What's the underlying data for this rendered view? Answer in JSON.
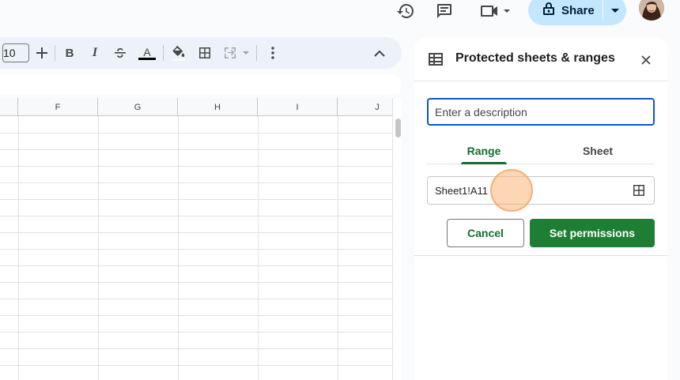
{
  "header": {
    "share_label": "Share",
    "icons": [
      "history-icon",
      "comment-icon",
      "meet-video-icon",
      "lock-icon",
      "caret-down-icon"
    ]
  },
  "toolbar": {
    "font_size": "10",
    "icons": [
      "plus-icon",
      "bold-icon",
      "italic-icon",
      "strikethrough-icon",
      "text-color-icon",
      "fill-color-icon",
      "borders-icon",
      "merge-cells-icon",
      "more-vert-icon",
      "collapse-icon"
    ],
    "text_color": "#000000"
  },
  "grid": {
    "columns": [
      "F",
      "G",
      "H",
      "I",
      "J"
    ],
    "row_count": 16
  },
  "panel": {
    "title": "Protected sheets & ranges",
    "description_placeholder": "Enter a description",
    "tabs": [
      {
        "label": "Range",
        "active": true
      },
      {
        "label": "Sheet",
        "active": false
      }
    ],
    "range_value": "Sheet1!A11",
    "cancel_label": "Cancel",
    "set_permissions_label": "Set permissions"
  },
  "colors": {
    "accent_green": "#146c2e",
    "button_green": "#1e7e34",
    "focus_blue": "#0b57d0",
    "share_bg": "#c2e7ff"
  }
}
